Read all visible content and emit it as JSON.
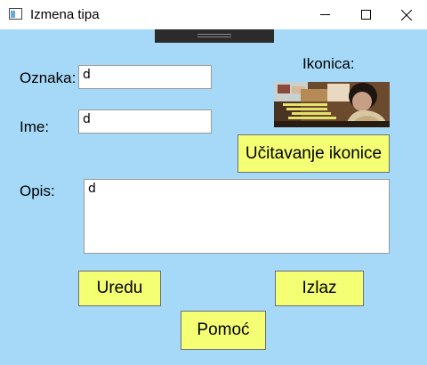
{
  "window": {
    "title": "Izmena tipa"
  },
  "form": {
    "oznaka_label": "Oznaka:",
    "oznaka_value": "d",
    "ime_label": "Ime:",
    "ime_value": "d",
    "opis_label": "Opis:",
    "opis_value": "d",
    "ikonica_label": "Ikonica:"
  },
  "buttons": {
    "load_icon": "Učitavanje ikonice",
    "ok": "Uredu",
    "exit": "Izlaz",
    "help": "Pomoć"
  },
  "colors": {
    "background": "#a6d8f8",
    "button": "#f5ff74"
  }
}
